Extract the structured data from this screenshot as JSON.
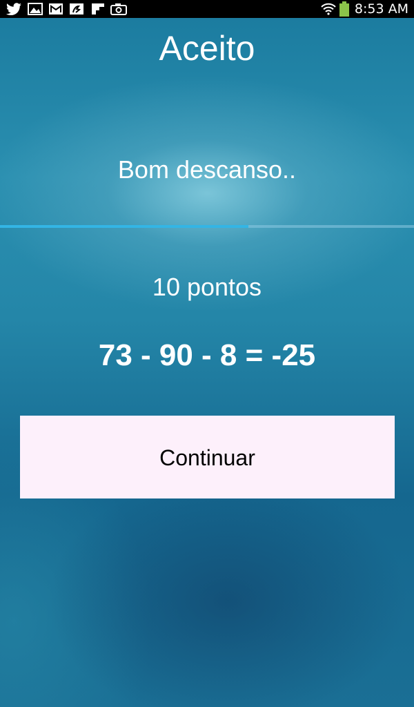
{
  "status_bar": {
    "time": "8:53 AM",
    "notification_icons": [
      "twitter-icon",
      "gallery-icon",
      "gmail-icon",
      "app-icon",
      "flipboard-icon",
      "camera-icon"
    ],
    "system_icons": [
      "wifi-icon",
      "battery-icon"
    ]
  },
  "screen": {
    "title": "Aceito",
    "message": "Bom descanso..",
    "progress": 0.6,
    "points_text": "10 pontos",
    "equation": "73 - 90 - 8 = -25",
    "continue_label": "Continuar"
  },
  "colors": {
    "progress_fill": "#33b5e5",
    "button_background": "#fdf0fb",
    "battery": "#8bc34a"
  }
}
